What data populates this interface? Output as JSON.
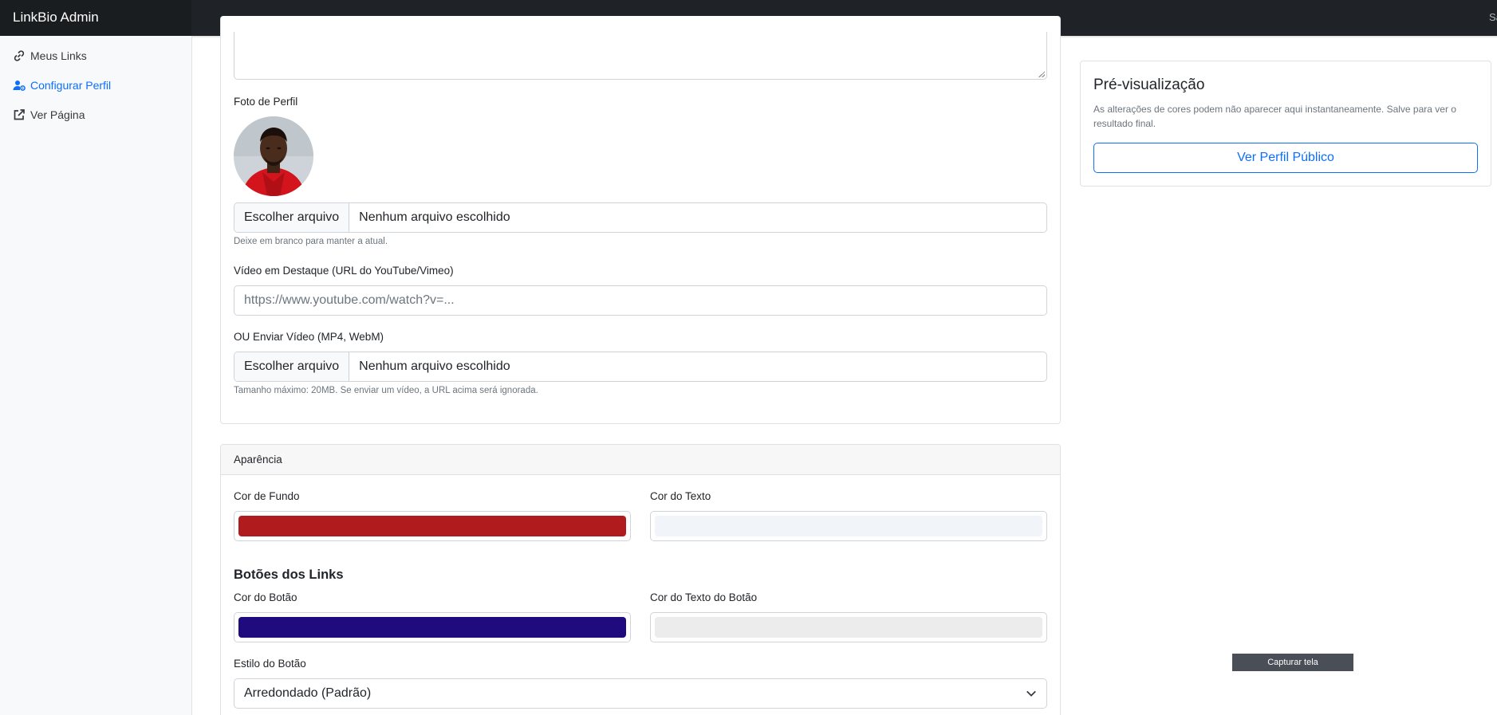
{
  "app": {
    "brand": "LinkBio Admin",
    "user_text": "Sair"
  },
  "sidebar": {
    "items": [
      {
        "label": "Meus Links",
        "icon": "link-icon",
        "active": false
      },
      {
        "label": "Configurar Perfil",
        "icon": "user-gear-icon",
        "active": true
      },
      {
        "label": "Ver Página",
        "icon": "external-link-icon",
        "active": false
      }
    ]
  },
  "profile": {
    "photo_label": "Foto de Perfil",
    "photo_file": {
      "button": "Escolher arquivo",
      "value": "Nenhum arquivo escolhido"
    },
    "photo_hint": "Deixe em branco para manter a atual.",
    "video_url_label": "Vídeo em Destaque (URL do YouTube/Vimeo)",
    "video_url_placeholder": "https://www.youtube.com/watch?v=...",
    "video_upload_label": "OU Enviar Vídeo (MP4, WebM)",
    "video_file": {
      "button": "Escolher arquivo",
      "value": "Nenhum arquivo escolhido"
    },
    "video_hint": "Tamanho máximo: 20MB. Se enviar um vídeo, a URL acima será ignorada."
  },
  "appearance": {
    "header": "Aparência",
    "bg_color_label": "Cor de Fundo",
    "bg_color": "#b01c1e",
    "text_color_label": "Cor do Texto",
    "text_color": "#f1f5f9",
    "buttons_title": "Botões dos Links",
    "button_color_label": "Cor do Botão",
    "button_color": "#1f0b7e",
    "button_text_color_label": "Cor do Texto do Botão",
    "button_text_color": "#ececec",
    "button_style_label": "Estilo do Botão",
    "button_style_value": "Arredondado (Padrão)"
  },
  "preview": {
    "title": "Pré-visualização",
    "description": "As alterações de cores podem não aparecer aqui instantaneamente. Salve para ver o resultado final.",
    "button": "Ver Perfil Público"
  },
  "overlay": {
    "capture_label": "Capturar tela"
  }
}
